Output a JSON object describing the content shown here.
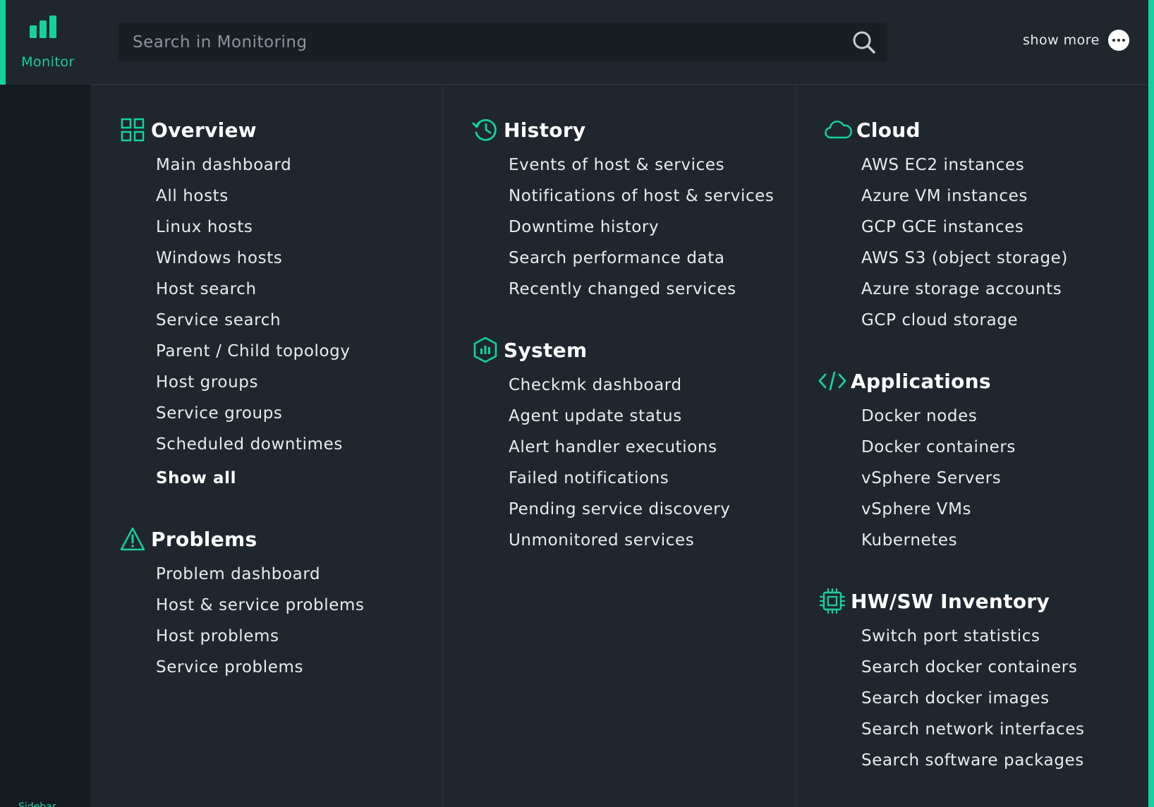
{
  "sidebar": {
    "active_label": "Monitor",
    "footer_text": "Sidebar"
  },
  "header": {
    "search_placeholder": "Search in Monitoring",
    "show_more_label": "show more"
  },
  "colors": {
    "accent": "#15d1a0",
    "background": "#1f262e",
    "sidebar_bg": "#131a20"
  },
  "sections": {
    "overview": {
      "title": "Overview",
      "icon": "grid-icon",
      "items": [
        "Main dashboard",
        "All hosts",
        "Linux hosts",
        "Windows hosts",
        "Host search",
        "Service search",
        "Parent / Child topology",
        "Host groups",
        "Service groups",
        "Scheduled downtimes"
      ],
      "show_all": "Show all"
    },
    "problems": {
      "title": "Problems",
      "icon": "warning-triangle-icon",
      "items": [
        "Problem dashboard",
        "Host & service problems",
        "Host problems",
        "Service problems"
      ]
    },
    "history": {
      "title": "History",
      "icon": "history-clock-icon",
      "items": [
        "Events of host & services",
        "Notifications of host & services",
        "Downtime history",
        "Search performance data",
        "Recently changed services"
      ]
    },
    "system": {
      "title": "System",
      "icon": "system-hexagon-icon",
      "items": [
        "Checkmk dashboard",
        "Agent update status",
        "Alert handler executions",
        "Failed notifications",
        "Pending service discovery",
        "Unmonitored services"
      ]
    },
    "cloud": {
      "title": "Cloud",
      "icon": "cloud-icon",
      "items": [
        "AWS EC2 instances",
        "Azure VM instances",
        "GCP GCE instances",
        "AWS S3 (object storage)",
        "Azure storage accounts",
        "GCP cloud storage"
      ]
    },
    "applications": {
      "title": "Applications",
      "icon": "code-icon",
      "items": [
        "Docker nodes",
        "Docker containers",
        "vSphere Servers",
        "vSphere VMs",
        "Kubernetes"
      ]
    },
    "inventory": {
      "title": "HW/SW Inventory",
      "icon": "chip-icon",
      "items": [
        "Switch port statistics",
        "Search docker containers",
        "Search docker images",
        "Search network interfaces",
        "Search software packages"
      ]
    }
  }
}
